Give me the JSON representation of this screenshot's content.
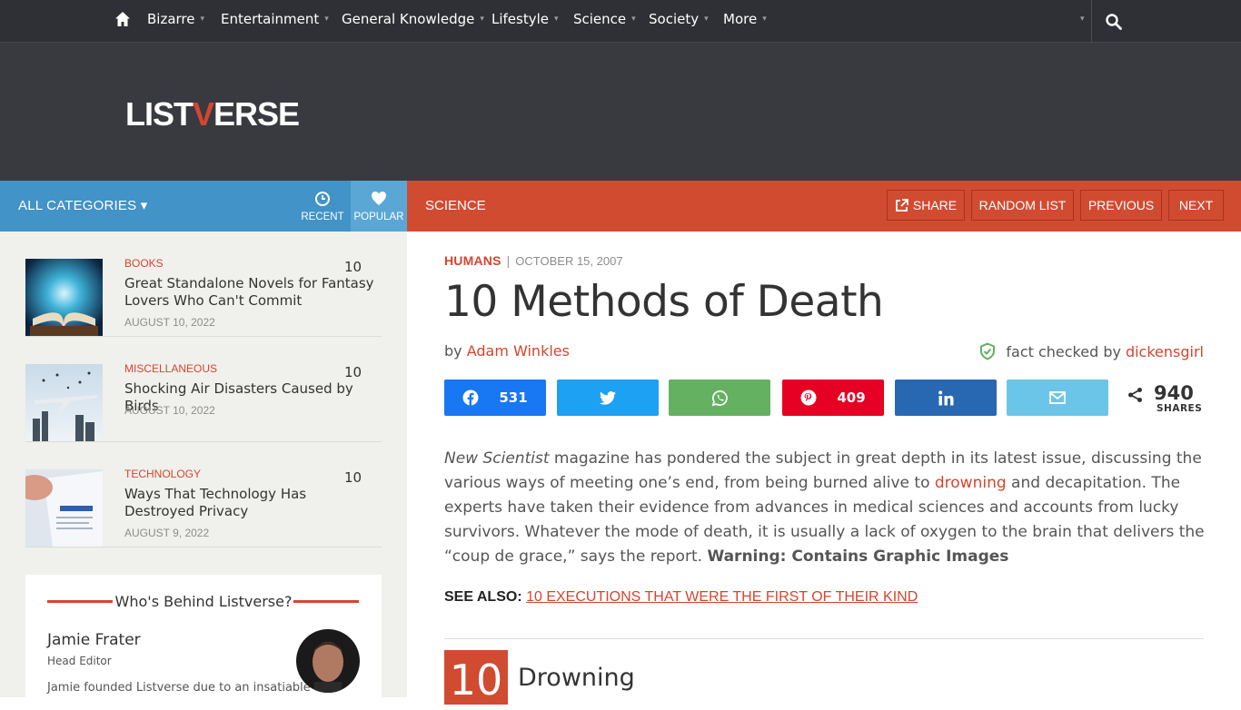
{
  "topnav": {
    "items": [
      {
        "label": "Bizarre"
      },
      {
        "label": "Entertainment"
      },
      {
        "label": "General Knowledge"
      },
      {
        "label": "Lifestyle"
      },
      {
        "label": "Science"
      },
      {
        "label": "Society"
      },
      {
        "label": "More"
      }
    ],
    "caret": "▾",
    "icons": [
      "home-icon",
      "search-icon"
    ]
  },
  "brand": {
    "logo_left": "LIST",
    "logo_v": "V",
    "logo_right": "ERSE"
  },
  "sidebar": {
    "all_categories": "ALL CATEGORIES ▾",
    "tabs": [
      {
        "label": "RECENT"
      },
      {
        "label": "POPULAR"
      }
    ],
    "cards": [
      {
        "category": "BOOKS",
        "count": "10",
        "title": "Great Standalone Novels for Fantasy Lovers Who Can't Commit",
        "date": "AUGUST 10, 2022"
      },
      {
        "category": "MISCELLANEOUS",
        "count": "10",
        "title": "Shocking Air Disasters Caused by Birds",
        "date": "AUGUST 10, 2022"
      },
      {
        "category": "TECHNOLOGY",
        "count": "10",
        "title": "Ways That Technology Has Destroyed Privacy",
        "date": "AUGUST 9, 2022"
      }
    ],
    "who": {
      "title": "Who's Behind Listverse?",
      "name": "Jamie Frater",
      "role": "Head Editor",
      "desc": "Jamie founded Listverse due to an insatiable"
    }
  },
  "redbar": {
    "section": "SCIENCE",
    "share": "SHARE",
    "random": "RANDOM LIST",
    "previous": "PREVIOUS",
    "next": "NEXT"
  },
  "article": {
    "category": "HUMANS",
    "separator": "|",
    "date": "OCTOBER 15, 2007",
    "title": "10 Methods of Death",
    "by": "by",
    "author": "Adam Winkles",
    "fact_checked_by": "fact checked by",
    "fact_checker": "dickensgirl",
    "share_buttons": [
      {
        "network": "facebook",
        "count": "531",
        "color": "#1877f2"
      },
      {
        "network": "twitter",
        "count": "",
        "color": "#1da1f2"
      },
      {
        "network": "whatsapp",
        "count": "",
        "color": "#64b161"
      },
      {
        "network": "pinterest",
        "count": "409",
        "color": "#e60023"
      },
      {
        "network": "linkedin",
        "count": "",
        "color": "#2867b2"
      },
      {
        "network": "email",
        "count": "",
        "color": "#6bc5e8"
      }
    ],
    "total_shares": "940",
    "shares_label": "SHARES",
    "intro": {
      "magazine": "New Scientist",
      "p1": " magazine has pondered the subject in great depth in its latest issue, discussing the various ways of meeting one’s end, from being burned alive to ",
      "link": "drowning",
      "p2": " and decapitation. The experts have taken their evidence from advances in medical sciences and accounts from lucky survivors. Whatever the mode of death, it is usually a lack of oxygen to the brain that delivers the “coup de grace,” says the report. ",
      "warning": "Warning: Contains Graphic Images"
    },
    "see_also_label": "SEE ALSO:",
    "see_also_link": "10 EXECUTIONS THAT WERE THE FIRST OF THEIR KIND",
    "entry_number": "10",
    "entry_title": "Drowning"
  },
  "colors": {
    "accent": "#d14b31",
    "blue": "#4293c7",
    "dark": "#2e3035"
  }
}
